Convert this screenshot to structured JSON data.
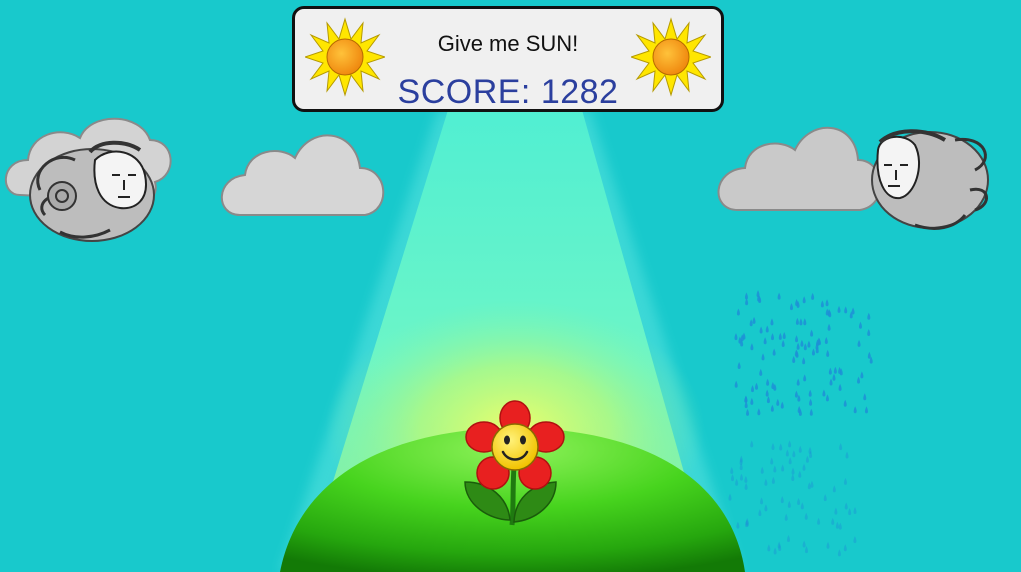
{
  "hud": {
    "title": "Give me SUN!",
    "score_label": "SCORE:",
    "score_value": "1282",
    "score_text": "SCORE: 1282"
  },
  "icons": {
    "hud_left": "sun-icon",
    "hud_right": "sun-icon",
    "player": "smiling-flower-icon",
    "wind_left": "wind-god-face-icon",
    "wind_right": "wind-god-face-icon",
    "rain": "raindrops-icon"
  },
  "colors": {
    "sky": "#18c9cc",
    "beam": "#5cf5d8",
    "hill": "#37c21a",
    "petal": "#e82020",
    "face": "#ffe23a",
    "score_text": "#2b3f9e",
    "sun_rays": "#ffe600",
    "sun_core": "#f7a21b",
    "rain": "#1e8fd6"
  }
}
